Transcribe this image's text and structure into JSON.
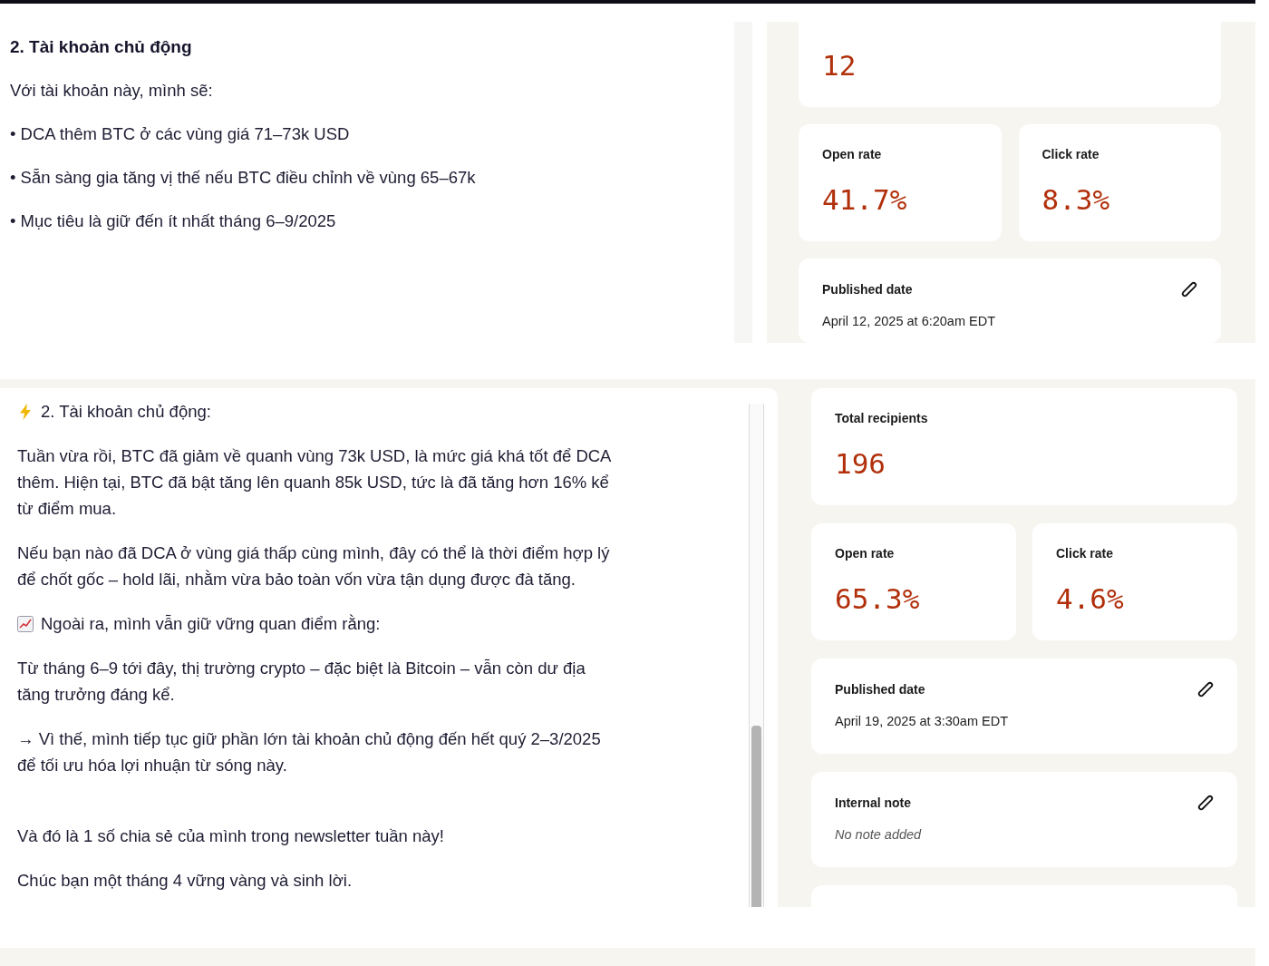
{
  "panels": [
    {
      "article": {
        "heading": "2. Tài khoản chủ động",
        "paragraphs": [
          {
            "kind": "text",
            "text": "Với tài khoản này, mình sẽ:"
          },
          {
            "kind": "text",
            "text": "• DCA thêm BTC ở các vùng giá 71–73k USD"
          },
          {
            "kind": "text",
            "text": "• Sẵn sàng gia tăng vị thế nếu BTC điều chỉnh về vùng 65–67k"
          },
          {
            "kind": "text",
            "text": "• Mục tiêu là giữ đến ít nhất tháng 6–9/2025"
          }
        ]
      },
      "stats": {
        "recipients": {
          "value": "12"
        },
        "rates": [
          {
            "label": "Open rate",
            "value": "41.7%"
          },
          {
            "label": "Click rate",
            "value": "8.3%"
          }
        ],
        "details": [
          {
            "kind": "field",
            "label": "Published date",
            "value": "April 12, 2025 at 6:20am EDT",
            "empty": false,
            "editable": true
          }
        ]
      }
    },
    {
      "article": {
        "paragraphs": [
          {
            "kind": "bolt",
            "text": "2. Tài khoản chủ động:"
          },
          {
            "kind": "text",
            "text": "Tuần vừa rồi, BTC đã giảm về quanh vùng 73k USD, là mức giá khá tốt để DCA thêm. Hiện tại, BTC đã bật tăng lên quanh 85k USD, tức là đã tăng hơn 16% kể từ điểm mua."
          },
          {
            "kind": "text",
            "text": "Nếu bạn nào đã DCA ở vùng giá thấp cùng mình, đây có thể là thời điểm hợp lý để chốt gốc – hold lãi, nhằm vừa bảo toàn vốn vừa tận dụng được đà tăng."
          },
          {
            "kind": "chart",
            "text": "Ngoài ra, mình vẫn giữ vững quan điểm rằng:"
          },
          {
            "kind": "text",
            "text": "Từ tháng 6–9 tới đây, thị trường crypto – đặc biệt là Bitcoin – vẫn còn dư địa tăng trưởng đáng kể."
          },
          {
            "kind": "text",
            "text": "→ Vì thế, mình tiếp tục giữ phần lớn tài khoản chủ động đến hết quý 2–3/2025 để tối ưu hóa lợi nhuận từ sóng này."
          },
          {
            "kind": "break"
          },
          {
            "kind": "text",
            "text": "Và đó là 1 số chia sẻ của mình trong newsletter tuần này!"
          },
          {
            "kind": "text",
            "text": "Chúc bạn một tháng 4 vững vàng và sinh lời."
          }
        ]
      },
      "stats": {
        "recipients": {
          "label": "Total recipients",
          "value": "196"
        },
        "rates": [
          {
            "label": "Open rate",
            "value": "65.3%"
          },
          {
            "label": "Click rate",
            "value": "4.6%"
          }
        ],
        "details": [
          {
            "kind": "field",
            "label": "Published date",
            "value": "April 19, 2025 at 3:30am EDT",
            "empty": false,
            "editable": true
          },
          {
            "kind": "field",
            "label": "Internal note",
            "value": "No note added",
            "empty": true,
            "editable": true
          },
          {
            "kind": "empty"
          }
        ]
      }
    }
  ]
}
